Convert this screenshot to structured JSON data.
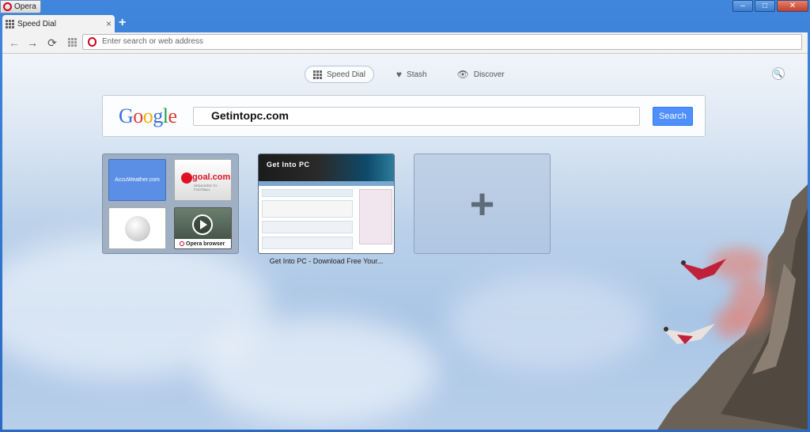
{
  "window": {
    "app_title": "Opera",
    "controls": [
      "–",
      "□",
      "✕"
    ]
  },
  "tabs": [
    {
      "label": "Speed Dial",
      "close": "×"
    }
  ],
  "new_tab": "+",
  "toolbar": {
    "back": "←",
    "forward": "→",
    "reload": "⟳"
  },
  "address_bar": {
    "placeholder": "Enter search or web address"
  },
  "speed_nav": {
    "items": [
      {
        "label": "Speed Dial"
      },
      {
        "label": "Stash"
      },
      {
        "label": "Discover"
      }
    ]
  },
  "search": {
    "logo": [
      "G",
      "o",
      "o",
      "g",
      "l",
      "e"
    ],
    "query": "Getintopc.com",
    "button": "Search"
  },
  "colors": {
    "google": [
      "#3b6fdf",
      "#dd3b2d",
      "#f1b100",
      "#3b6fdf",
      "#1fa24a",
      "#dd3b2d"
    ]
  },
  "tiles": {
    "folder": {
      "accuweather": "AccuWeather.com",
      "goal": "goal.com",
      "goal_sub": "DEDICATED TO FOOTBALL",
      "opera": "Opera browser"
    },
    "site": {
      "header": "Get Into PC",
      "caption": "Get Into PC - Download Free Your..."
    },
    "add": "+"
  }
}
